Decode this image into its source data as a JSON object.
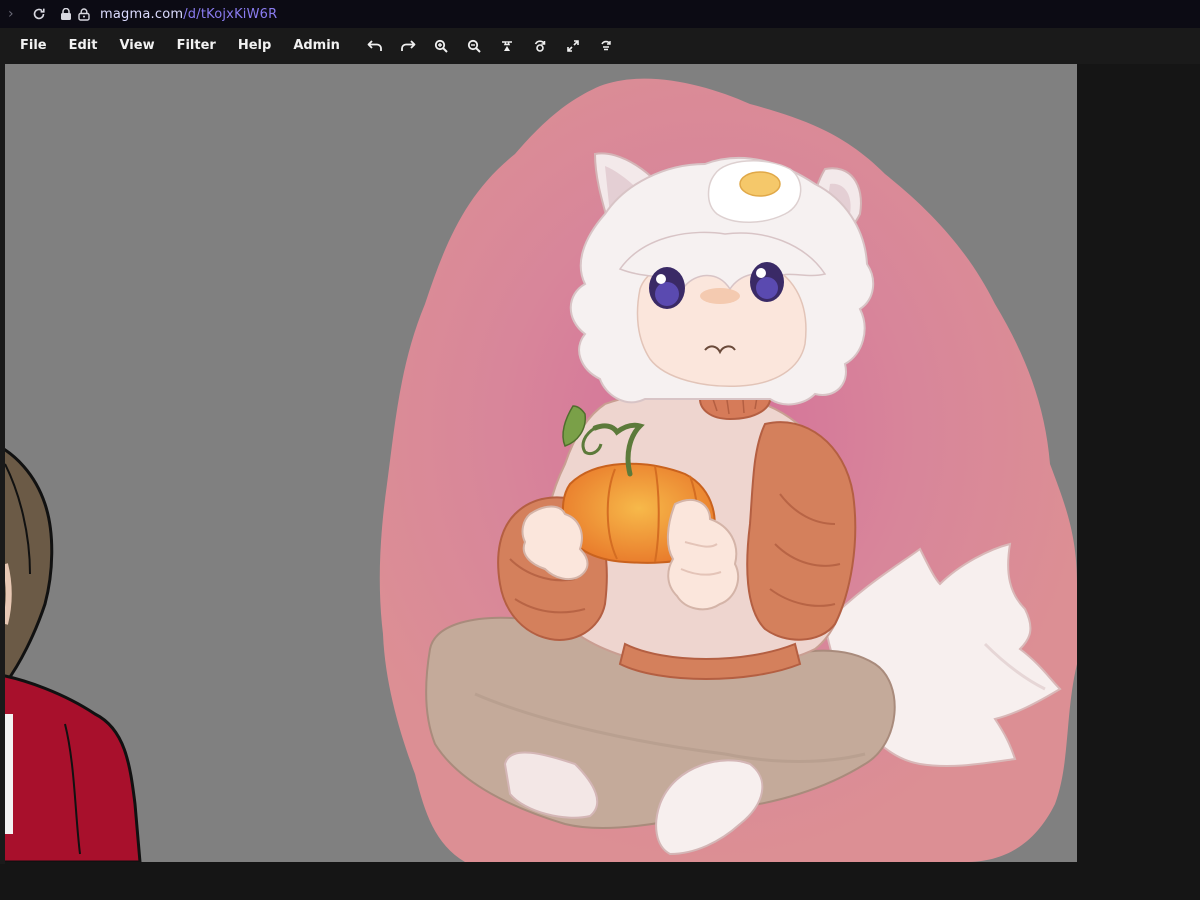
{
  "browser": {
    "url_host": "magma.com",
    "url_path": "/d/tKojxKiW6R"
  },
  "menubar": {
    "items": [
      "File",
      "Edit",
      "View",
      "Filter",
      "Help",
      "Admin"
    ],
    "tools": [
      "undo-icon",
      "redo-icon",
      "zoom-in-icon",
      "zoom-out-icon",
      "reset-view-icon",
      "rotate-icon",
      "fullscreen-icon",
      "mirror-icon"
    ]
  },
  "canvas": {
    "background": "#808080",
    "artwork": "cat-person-with-pumpkin"
  },
  "colors": {
    "accent": "#8a7cf0",
    "menubar": "#1a1a1a",
    "canvas": "#808080",
    "blob": "#d88a93",
    "pumpkin": "#f0922e",
    "sweater": "#d4805c",
    "pants": "#c0a898",
    "red-coat": "#a8102c"
  }
}
